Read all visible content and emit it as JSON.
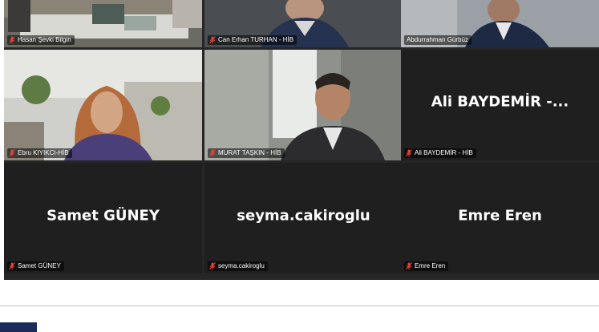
{
  "participants": [
    {
      "name": "Hasan Şevki Bilgin",
      "muted": true,
      "video": true
    },
    {
      "name": "Can Erhan TURHAN - HİB",
      "muted": true,
      "video": true
    },
    {
      "name": "Abdurrahman Gürbüz",
      "muted": false,
      "video": true,
      "active_speaker": true
    },
    {
      "name": "Ebru KIYIKCI-HİB",
      "muted": true,
      "video": true
    },
    {
      "name": "MURAT TAŞKIN - HİB",
      "muted": true,
      "video": true
    },
    {
      "name": "Ali BAYDEMİR - HİB",
      "muted": true,
      "video": false,
      "display_text": "Ali  BAYDEMİR -..."
    },
    {
      "name": "Samet GÜNEY",
      "muted": true,
      "video": false,
      "display_text": "Samet GÜNEY"
    },
    {
      "name": "seyma.cakiroglu",
      "muted": true,
      "video": false,
      "display_text": "seyma.cakiroglu"
    },
    {
      "name": "Emre Eren",
      "muted": true,
      "video": false,
      "display_text": "Emre Eren"
    }
  ],
  "colors": {
    "active_speaker_border": "#c9d94a",
    "muted_icon": "#e0463a",
    "tile_bg": "#1f1f1f"
  }
}
